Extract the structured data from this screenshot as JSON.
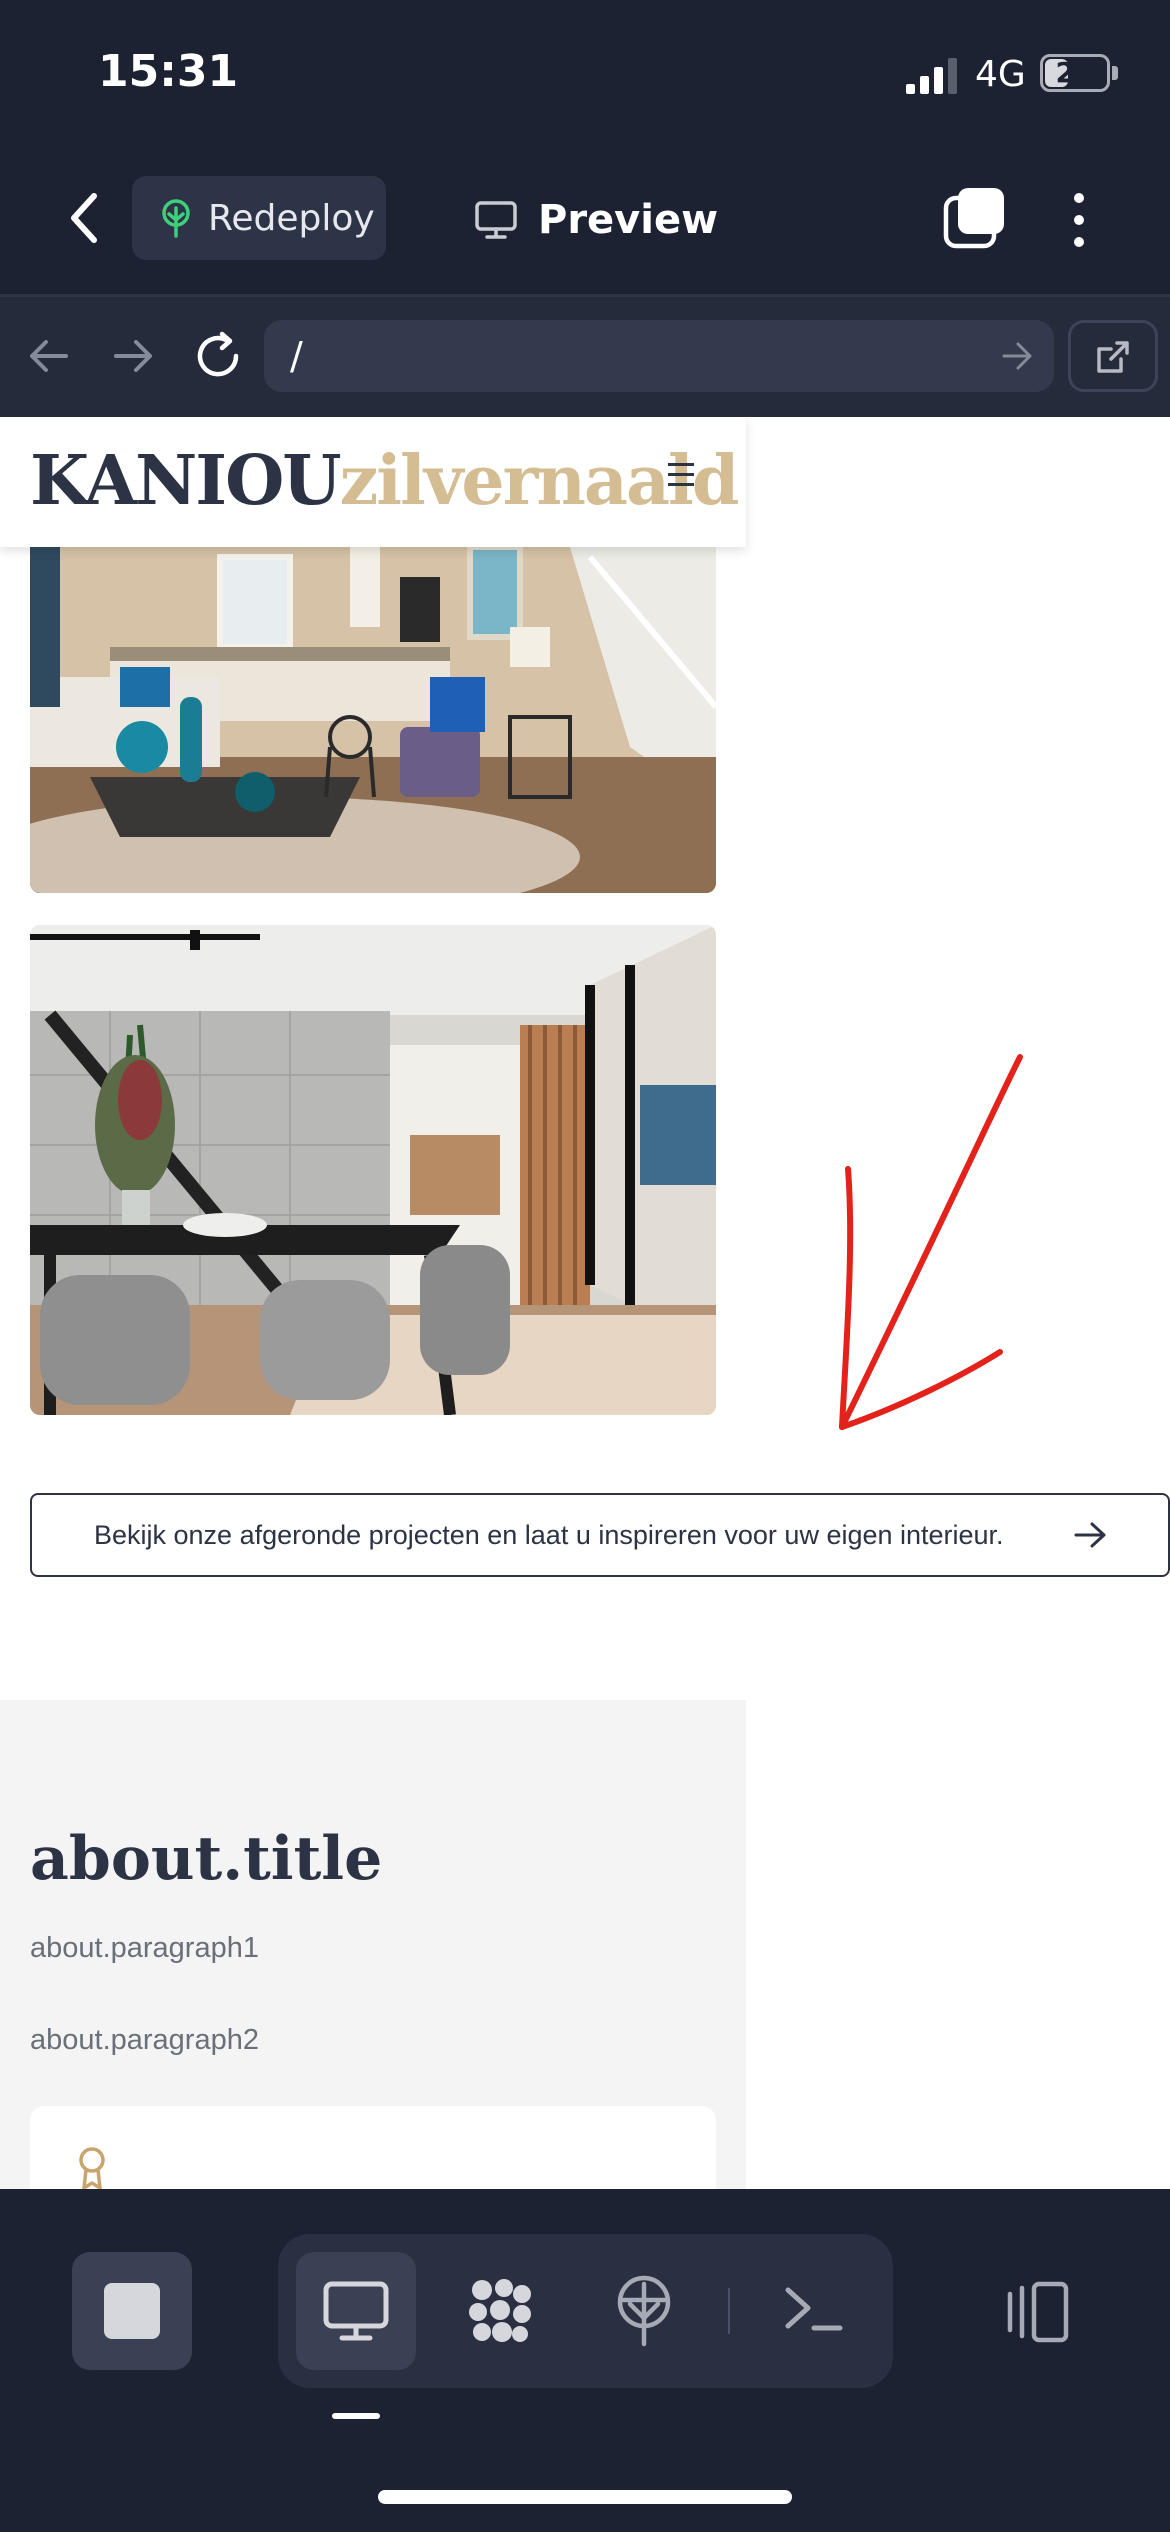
{
  "status": {
    "time": "15:31",
    "network": "4G",
    "battery": "21"
  },
  "topnav": {
    "redeploy_label": "Redeploy",
    "preview_label": "Preview"
  },
  "browser": {
    "url": "/"
  },
  "site": {
    "logo_part1": "KANIOU",
    "logo_part2": "zilvernaald",
    "cta_text": "Bekijk onze afgeronde projecten en laat u inspireren voor uw eigen interieur.",
    "about_title": "about.title",
    "about_p1": "about.paragraph1",
    "about_p2": "about.paragraph2"
  },
  "colors": {
    "app_bg": "#1d2233",
    "accent_gold": "#d4bc93",
    "navy_text": "#2c3344",
    "annotation_red": "#e3231b",
    "deploy_green": "#3fcf7a"
  },
  "icons": {
    "back": "chevron-left-icon",
    "redeploy": "tree-icon",
    "preview": "monitor-icon",
    "tabs": "tabs-icon",
    "more": "more-vertical-icon",
    "reload": "reload-icon",
    "external": "external-link-icon",
    "menu": "hamburger-icon",
    "cta_arrow": "arrow-right-icon",
    "award": "award-icon",
    "stop": "stop-icon",
    "desktop": "desktop-icon",
    "apps": "apps-icon",
    "deploy": "deploy-icon",
    "terminal": "terminal-icon",
    "sidebar": "sidebar-icon"
  }
}
